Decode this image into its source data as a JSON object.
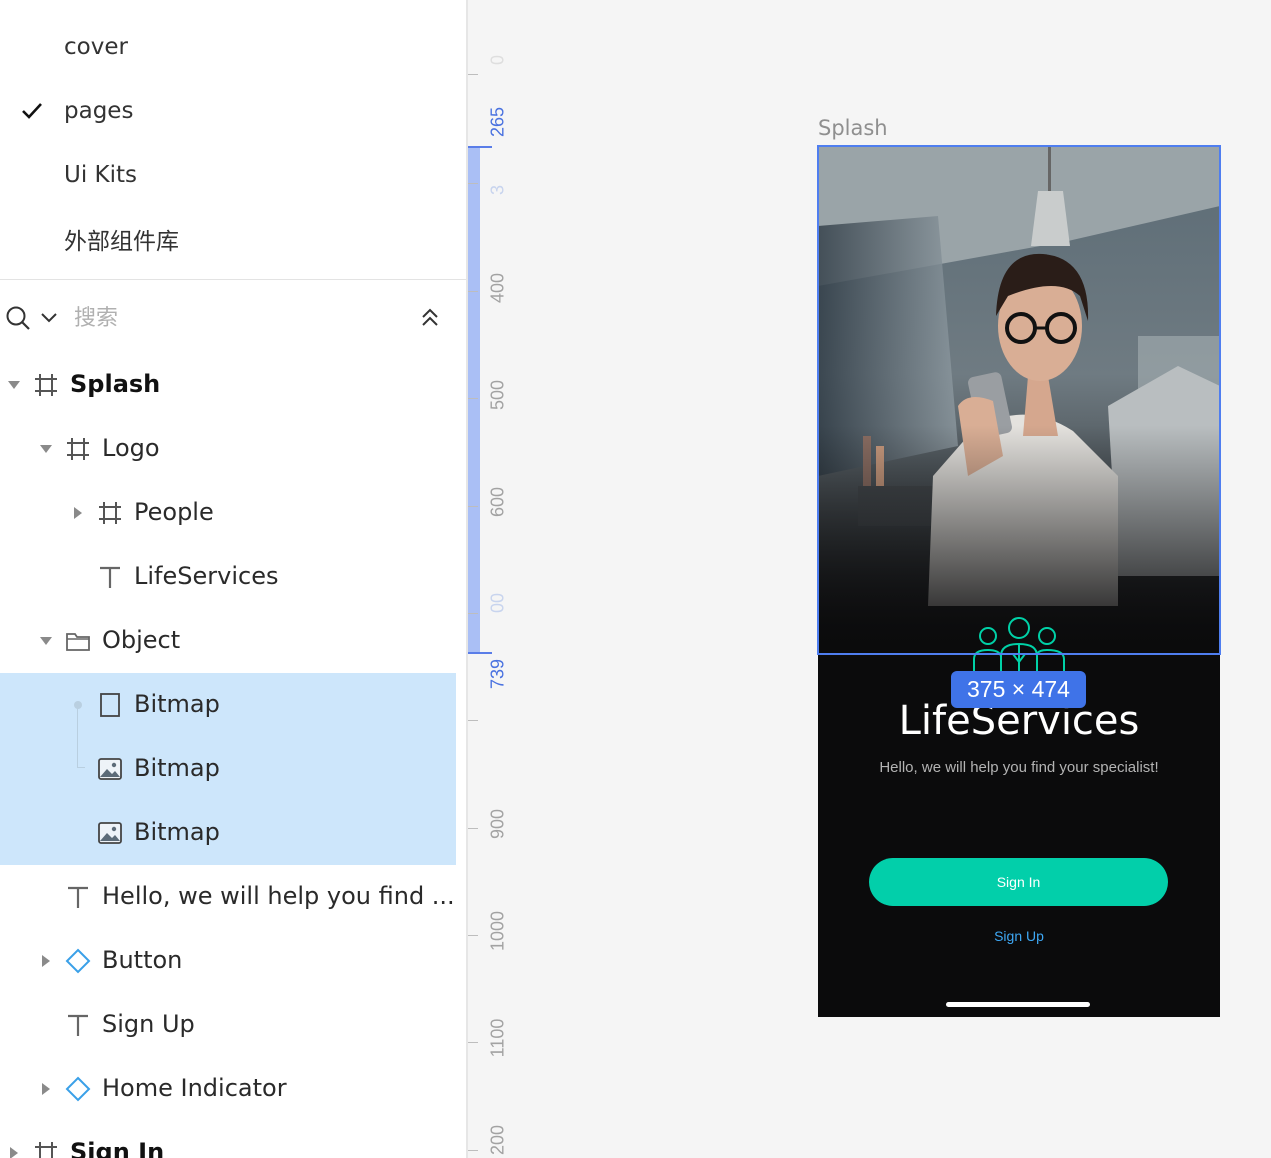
{
  "pages": [
    {
      "label": "cover",
      "checked": false
    },
    {
      "label": "pages",
      "checked": true
    },
    {
      "label": "Ui Kits",
      "checked": false
    },
    {
      "label": "外部组件库",
      "checked": false
    }
  ],
  "search": {
    "placeholder": "搜索"
  },
  "layers": [
    {
      "name": "Splash",
      "icon": "frame-icon",
      "caret": "expanded"
    },
    {
      "name": "Logo",
      "icon": "frame-icon",
      "caret": "expanded"
    },
    {
      "name": "People",
      "icon": "frame-icon",
      "caret": "collapsed"
    },
    {
      "name": "LifeServices",
      "icon": "text-icon",
      "caret": "none"
    },
    {
      "name": "Object",
      "icon": "folder-icon",
      "caret": "expanded"
    },
    {
      "name": "Bitmap",
      "icon": "rectangle-icon",
      "caret": "none",
      "selected": true
    },
    {
      "name": "Bitmap",
      "icon": "image-icon",
      "caret": "none",
      "selected": true
    },
    {
      "name": "Bitmap",
      "icon": "image-icon",
      "caret": "none",
      "selected": true
    },
    {
      "name": "Hello, we will help you find ...",
      "icon": "text-icon",
      "caret": "none"
    },
    {
      "name": "Button",
      "icon": "component-icon",
      "caret": "collapsed"
    },
    {
      "name": "Sign Up",
      "icon": "text-icon",
      "caret": "none"
    },
    {
      "name": "Home Indicator",
      "icon": "component-icon",
      "caret": "collapsed"
    },
    {
      "name": "Sign In",
      "icon": "frame-icon",
      "caret": "collapsed"
    }
  ],
  "ruler": {
    "labels": [
      "0",
      "265",
      "3",
      "400",
      "500",
      "600",
      "00",
      "739",
      "900",
      "1000",
      "1100",
      "200"
    ],
    "highlight_labels": [
      "265",
      "739"
    ]
  },
  "canvas": {
    "frame_label": "Splash",
    "selection_size": "375 × 474"
  },
  "app": {
    "title": "LifeServices",
    "subtitle": "Hello, we will help you find your specialist!",
    "signin_label": "Sign In",
    "signup_label": "Sign Up"
  },
  "colors": {
    "accent": "#02cfaa",
    "link": "#3ea8f5",
    "selection": "#4f7ef0",
    "layer_highlight": "#cde6fb",
    "app_background": "#0b0b0c"
  }
}
